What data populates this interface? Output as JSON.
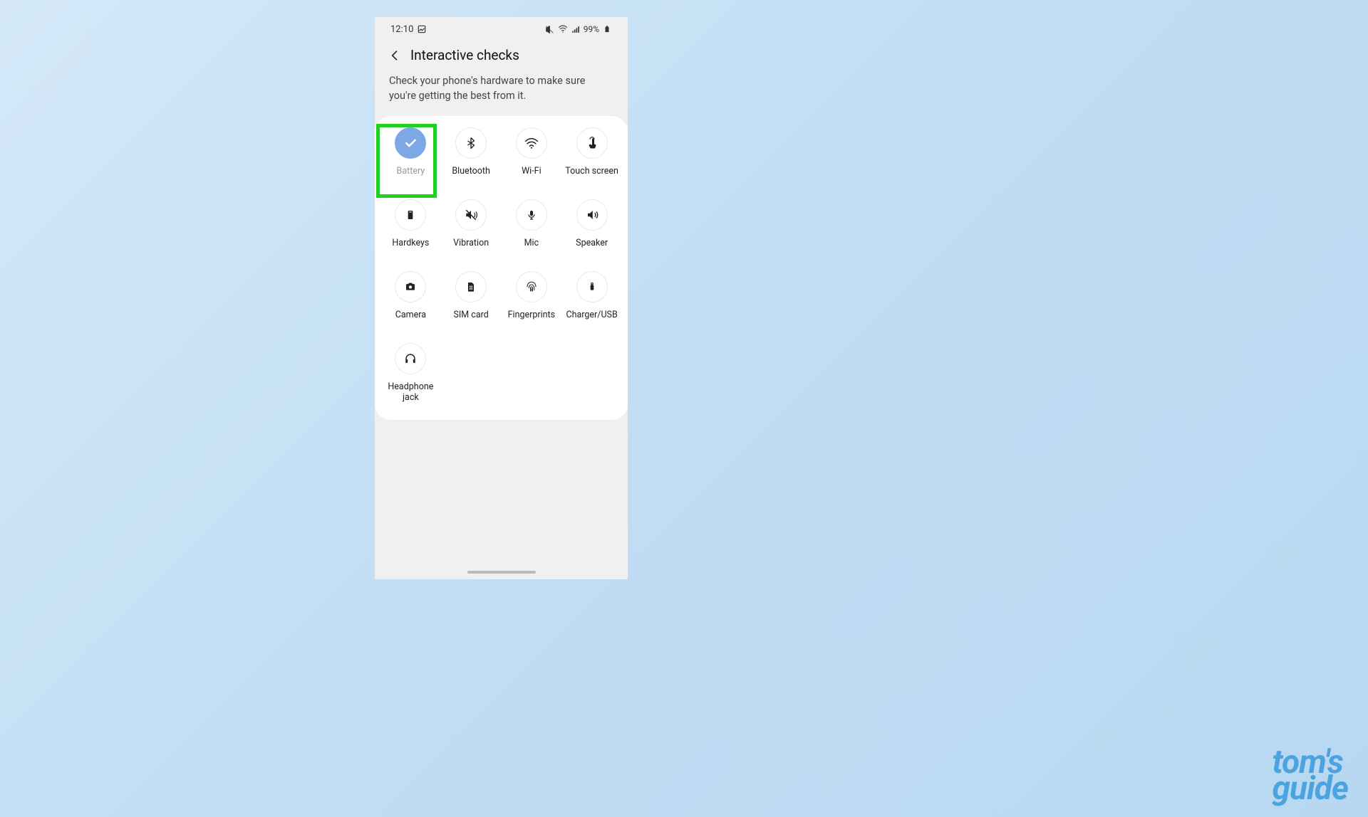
{
  "status_bar": {
    "time": "12:10",
    "battery_pct": "99%"
  },
  "header": {
    "title": "Interactive checks",
    "subtitle": "Check your phone's hardware to make sure you're getting the best from it."
  },
  "tiles": [
    {
      "label": "Battery",
      "icon": "check",
      "checked": true,
      "muted": true
    },
    {
      "label": "Bluetooth",
      "icon": "bluetooth",
      "checked": false,
      "muted": false
    },
    {
      "label": "Wi-Fi",
      "icon": "wifi",
      "checked": false,
      "muted": false
    },
    {
      "label": "Touch screen",
      "icon": "touch",
      "checked": false,
      "muted": false
    },
    {
      "label": "Hardkeys",
      "icon": "phone-rect",
      "checked": false,
      "muted": false
    },
    {
      "label": "Vibration",
      "icon": "vibration",
      "checked": false,
      "muted": false
    },
    {
      "label": "Mic",
      "icon": "mic",
      "checked": false,
      "muted": false
    },
    {
      "label": "Speaker",
      "icon": "speaker",
      "checked": false,
      "muted": false
    },
    {
      "label": "Camera",
      "icon": "camera",
      "checked": false,
      "muted": false
    },
    {
      "label": "SIM card",
      "icon": "sim",
      "checked": false,
      "muted": false
    },
    {
      "label": "Fingerprints",
      "icon": "fingerprint",
      "checked": false,
      "muted": false
    },
    {
      "label": "Charger/USB",
      "icon": "usb",
      "checked": false,
      "muted": false
    },
    {
      "label": "Headphone jack",
      "icon": "headphone",
      "checked": false,
      "muted": false
    }
  ],
  "highlight": {
    "tile_index": 0
  },
  "watermark": {
    "line1": "tom's",
    "line2": "guide"
  }
}
